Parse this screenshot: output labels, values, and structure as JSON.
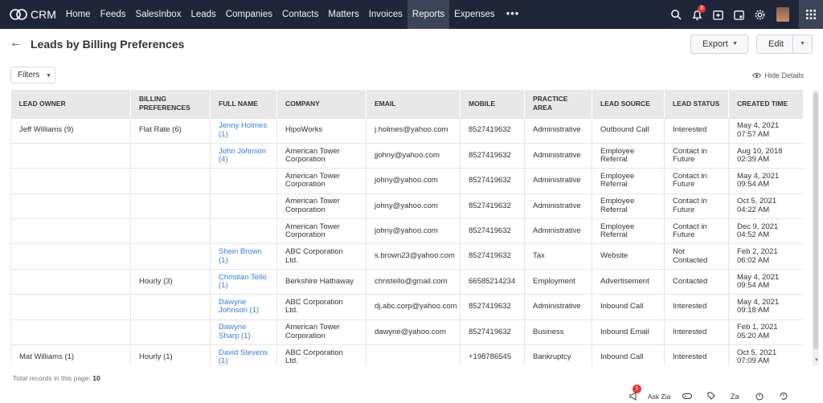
{
  "app": {
    "name": "CRM"
  },
  "nav": {
    "items": [
      {
        "label": "Home",
        "active": false
      },
      {
        "label": "Feeds",
        "active": false
      },
      {
        "label": "SalesInbox",
        "active": false
      },
      {
        "label": "Leads",
        "active": false
      },
      {
        "label": "Companies",
        "active": false
      },
      {
        "label": "Contacts",
        "active": false
      },
      {
        "label": "Matters",
        "active": false
      },
      {
        "label": "Invoices",
        "active": false
      },
      {
        "label": "Reports",
        "active": true
      },
      {
        "label": "Expenses",
        "active": false
      }
    ],
    "more": "•••",
    "notification_count": "3"
  },
  "header": {
    "title": "Leads by Billing Preferences",
    "export_label": "Export",
    "edit_label": "Edit"
  },
  "toolbar": {
    "filters_label": "Filters",
    "hide_details_label": "Hide Details"
  },
  "table": {
    "columns": [
      "LEAD OWNER",
      "BILLING PREFERENCES",
      "FULL NAME",
      "COMPANY",
      "EMAIL",
      "MOBILE",
      "PRACTICE AREA",
      "LEAD SOURCE",
      "LEAD STATUS",
      "CREATED TIME"
    ],
    "rows": [
      [
        "Jeff Williams (9)",
        "Flat Rate (6)",
        "Jenny Holmes (1)",
        "HipoWorks",
        "j.holmes@yahoo.com",
        "8527419632",
        "Administrative",
        "Outbound Call",
        "Interested",
        "May 4, 2021 07:57 AM"
      ],
      [
        "",
        "",
        "John Johnson (4)",
        "American Tower Corporation",
        "jjohny@yahoo.com",
        "8527419632",
        "Administrative",
        "Employee Referral",
        "Contact in Future",
        "Aug 10, 2018 02:39 AM"
      ],
      [
        "",
        "",
        "",
        "American Tower Corporation",
        "johny@yahoo.com",
        "8527419632",
        "Administrative",
        "Employee Referral",
        "Contact in Future",
        "May 4, 2021 09:54 AM"
      ],
      [
        "",
        "",
        "",
        "American Tower Corporation",
        "johny@yahoo.com",
        "8527419632",
        "Administrative",
        "Employee Referral",
        "Contact in Future",
        "Oct 5, 2021 04:22 AM"
      ],
      [
        "",
        "",
        "",
        "American Tower Corporation",
        "johny@yahoo.com",
        "8527419632",
        "Administrative",
        "Employee Referral",
        "Contact in Future",
        "Dec 9, 2021 04:52 AM"
      ],
      [
        "",
        "",
        "Shein Brown (1)",
        "ABC Corporation Ltd.",
        "s.brown23@yahoo.com",
        "8527419632",
        "Tax",
        "Website",
        "Not Contacted",
        "Feb 2, 2021 06:02 AM"
      ],
      [
        "",
        "Hourly (3)",
        "Christian Tello (1)",
        "Berkshire Hathaway",
        "christello@gmail.com",
        "66585214234",
        "Employment",
        "Advertisement",
        "Contacted",
        "May 4, 2021 09:54 AM"
      ],
      [
        "",
        "",
        "Dawyne Johnson (1)",
        "ABC Corporation Ltd.",
        "dj.abc.corp@yahoo.com",
        "8527419632",
        "Administrative",
        "Inbound Call",
        "Interested",
        "May 4, 2021 09:18 AM"
      ],
      [
        "",
        "",
        "Dawyne Sharp (1)",
        "American Tower Corporation",
        "dawyne@yahoo.com",
        "8527419632",
        "Business",
        "Inbound Email",
        "Interested",
        "Feb 1, 2021 05:20 AM"
      ],
      [
        "Mat Williams (1)",
        "Hourly (1)",
        "David Stevens (1)",
        "ABC Corporation Ltd.",
        "",
        "+198786545",
        "Bankruptcy",
        "Inbound Call",
        "Interested",
        "Oct 5, 2021 07:09 AM"
      ]
    ]
  },
  "footer": {
    "total_label": "Total records in this page:",
    "total_value": "10"
  },
  "bottombar": {
    "ask_zia_label": "Ask Zia",
    "badge": "1"
  },
  "colors": {
    "nav_bg": "#20263a",
    "nav_active": "#3c4457",
    "link": "#3a7bd5",
    "header_bg": "#e8e8e8",
    "badge": "#e53935"
  }
}
